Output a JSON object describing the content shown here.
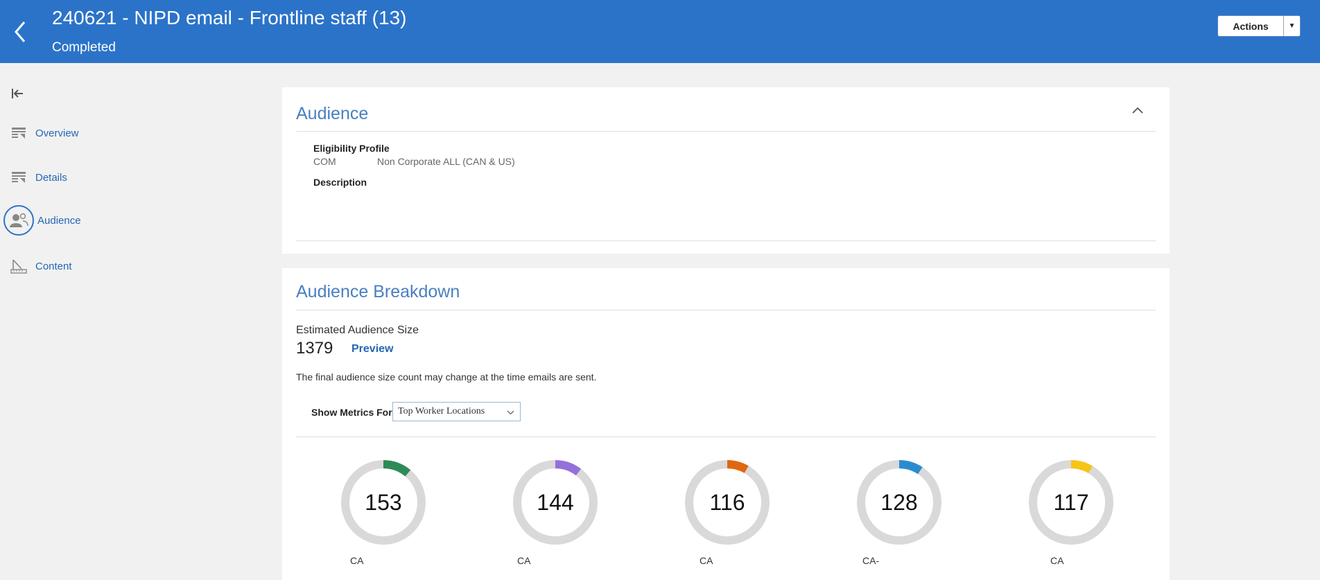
{
  "header": {
    "title": "240621 - NIPD email - Frontline staff (13)",
    "status": "Completed",
    "actions_label": "Actions",
    "brand_color": "#2b73c9"
  },
  "sidebar": {
    "items": [
      {
        "label": "Overview",
        "icon": "overview-icon"
      },
      {
        "label": "Details",
        "icon": "details-icon"
      },
      {
        "label": "Audience",
        "icon": "audience-icon",
        "active": true
      },
      {
        "label": "Content",
        "icon": "content-icon"
      }
    ]
  },
  "audience": {
    "title": "Audience",
    "eligibility_label": "Eligibility Profile",
    "eligibility_code": "COM",
    "eligibility_value": "Non Corporate ALL (CAN & US)",
    "description_label": "Description"
  },
  "breakdown": {
    "title": "Audience Breakdown",
    "estimated_label": "Estimated Audience Size",
    "estimated_value": "1379",
    "preview_label": "Preview",
    "note": "The final audience size count may change at the time emails are sent.",
    "metrics_label": "Show Metrics For",
    "metrics_selected": "Top Worker Locations",
    "donuts": [
      {
        "value": 153,
        "label": "CA",
        "color": "#2e8b57",
        "fraction": 0.111
      },
      {
        "value": 144,
        "label": "CA",
        "color": "#9370db",
        "fraction": 0.104
      },
      {
        "value": 116,
        "label": "CA",
        "color": "#e0670f",
        "fraction": 0.084
      },
      {
        "value": 128,
        "label": "CA-",
        "color": "#2a8ccf",
        "fraction": 0.093
      },
      {
        "value": 117,
        "label": "CA",
        "color": "#f5c518",
        "fraction": 0.085
      }
    ]
  }
}
